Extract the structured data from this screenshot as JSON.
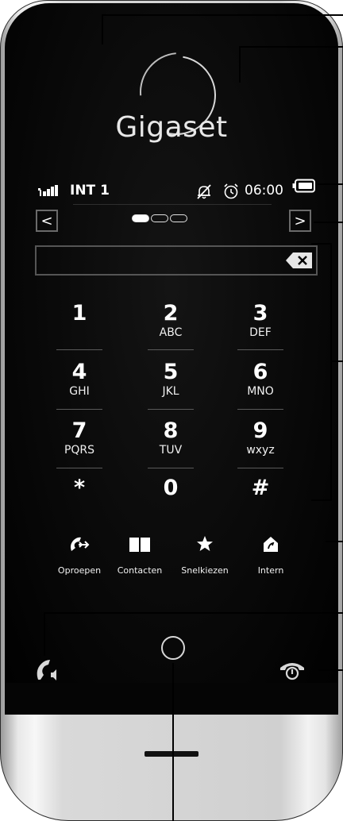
{
  "brand": "Gigaset",
  "status": {
    "int_label": "INT 1",
    "time": "06:00",
    "icons": [
      "signal-icon",
      "silent-bell-icon",
      "alarm-clock-icon",
      "battery-icon"
    ]
  },
  "pager": {
    "pages": 3,
    "active": 0,
    "prev_label": "<",
    "next_label": ">"
  },
  "input": {
    "value": ""
  },
  "keypad": [
    {
      "digit": "1",
      "letters": ""
    },
    {
      "digit": "2",
      "letters": "ABC"
    },
    {
      "digit": "3",
      "letters": "DEF"
    },
    {
      "digit": "4",
      "letters": "GHI"
    },
    {
      "digit": "5",
      "letters": "JKL"
    },
    {
      "digit": "6",
      "letters": "MNO"
    },
    {
      "digit": "7",
      "letters": "PQRS"
    },
    {
      "digit": "8",
      "letters": "TUV"
    },
    {
      "digit": "9",
      "letters": "wxyz"
    },
    {
      "digit": "*",
      "letters": ""
    },
    {
      "digit": "0",
      "letters": ""
    },
    {
      "digit": "#",
      "letters": ""
    }
  ],
  "actions": [
    {
      "label": "Oproepen",
      "icon": "call-list-icon"
    },
    {
      "label": "Contacten",
      "icon": "phonebook-icon"
    },
    {
      "label": "Snelkiezen",
      "icon": "star-icon"
    },
    {
      "label": "Intern",
      "icon": "house-icon"
    }
  ],
  "hardware": {
    "call_key": "call-handsfree-icon",
    "home_key": "home-button",
    "end_key": "end-call-icon"
  },
  "colors": {
    "screen": "#000000",
    "text": "#ffffff",
    "frame": "#d9d9d9"
  }
}
